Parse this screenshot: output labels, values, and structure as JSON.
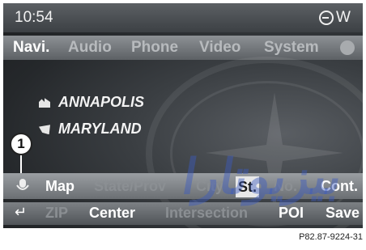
{
  "status": {
    "time": "10:54",
    "right_glyph": "W",
    "status_icon": "gps-signal-icon"
  },
  "menu": {
    "items": [
      {
        "label": "Navi.",
        "active": true
      },
      {
        "label": "Audio",
        "active": false
      },
      {
        "label": "Phone",
        "active": false
      },
      {
        "label": "Video",
        "active": false
      },
      {
        "label": "System",
        "active": false
      }
    ]
  },
  "destination": {
    "city": "ANNAPOLIS",
    "state": "MARYLAND"
  },
  "callout": {
    "number": "1"
  },
  "softkeys": {
    "row1": [
      {
        "label": "Map",
        "state": "on"
      },
      {
        "label": "State/Prov",
        "state": "off"
      },
      {
        "label": "City",
        "state": "off"
      },
      {
        "label": "St.",
        "state": "selected"
      },
      {
        "label": "No.",
        "state": "off"
      },
      {
        "label": "Cont.",
        "state": "on"
      }
    ],
    "row2": [
      {
        "label": "ZIP",
        "state": "off"
      },
      {
        "label": "Center",
        "state": "on"
      },
      {
        "label": "Intersection",
        "state": "off"
      },
      {
        "label": "POI",
        "state": "on"
      },
      {
        "label": "Save",
        "state": "on"
      }
    ]
  },
  "watermark": "ﺑﯿﺰﯾﻮﺗﺎرا",
  "caption": "P82.87-9224-31"
}
